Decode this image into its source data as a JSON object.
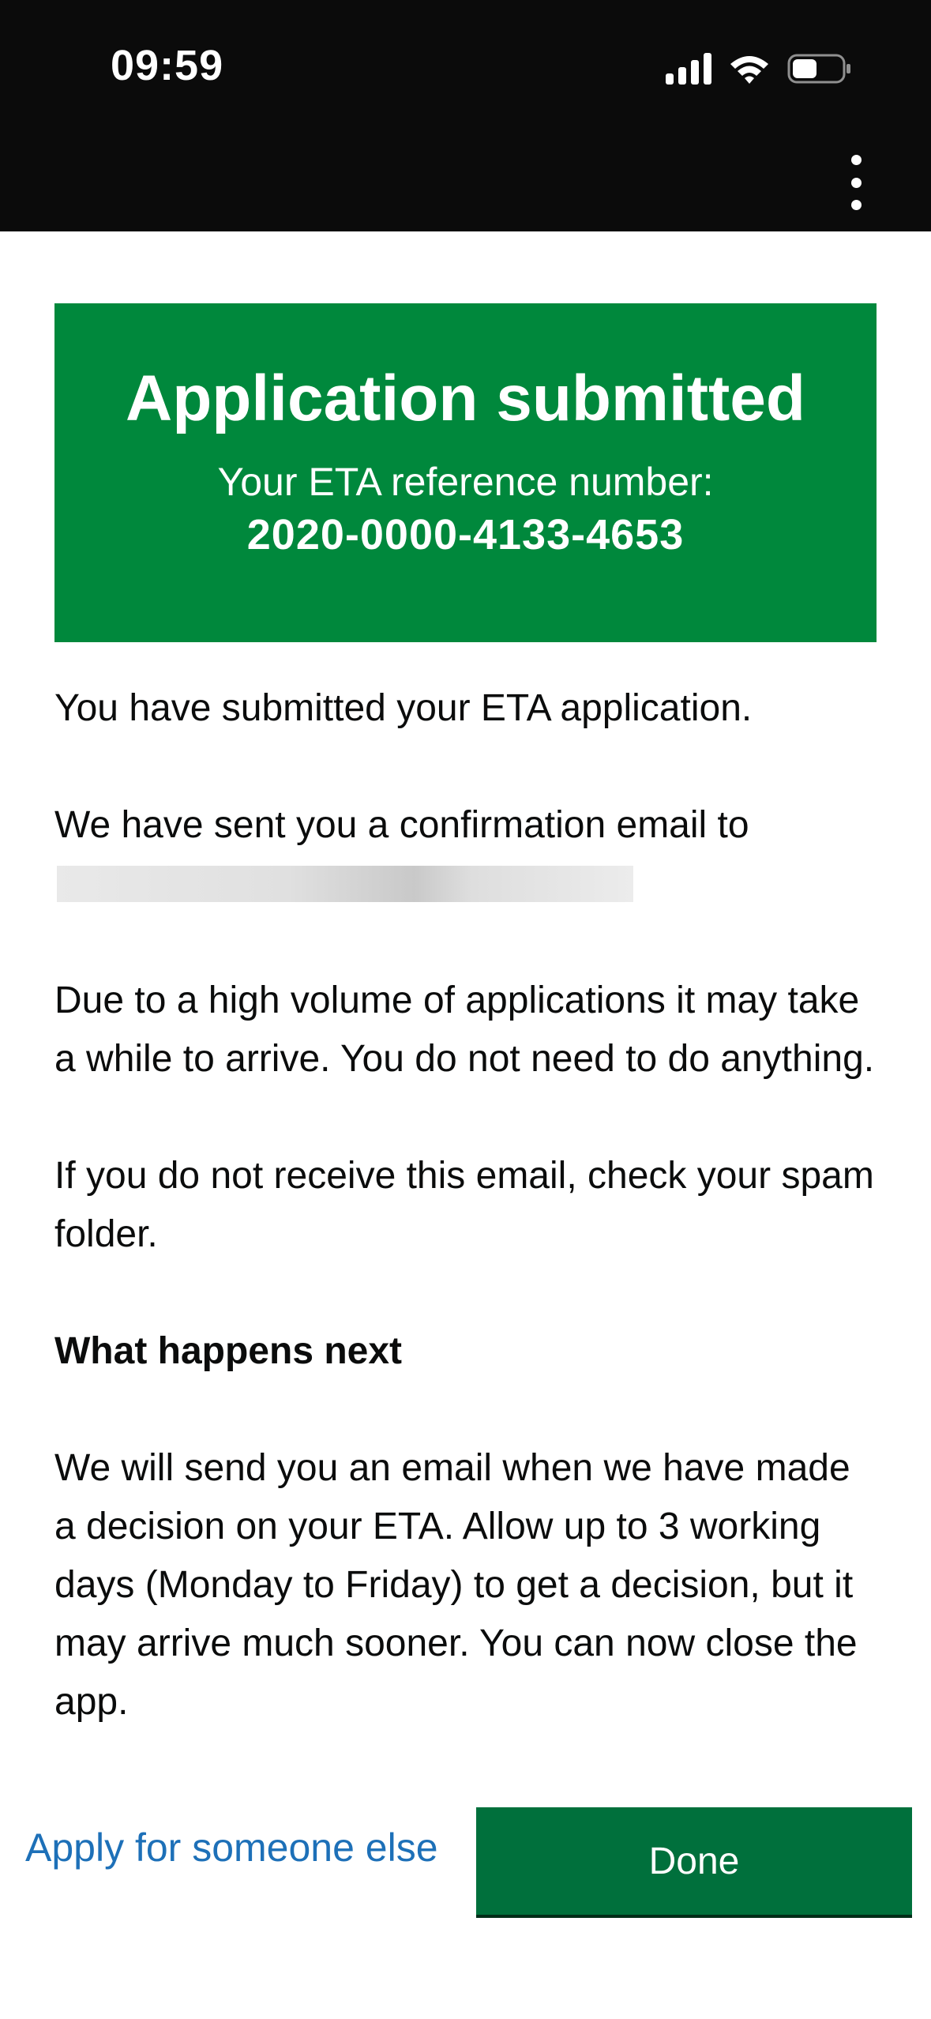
{
  "status_bar": {
    "time": "09:59",
    "icons": [
      "cellular-signal-icon",
      "wifi-icon",
      "battery-icon"
    ]
  },
  "header": {
    "menu_icon": "more-vertical-icon"
  },
  "confirmation_panel": {
    "title": "Application submitted",
    "reference_label": "Your ETA reference number:",
    "reference_number": "2020-0000-4133-4653",
    "color": "#00883c"
  },
  "body": {
    "para1": "You have submitted your ETA application.",
    "para2": "We have sent you a confirmation email to",
    "para3": "Due to a high volume of applications it may take a while to arrive. You do not need to do anything.",
    "para4": "If you do not receive this email, check your spam folder.",
    "heading": "What happens next",
    "para5": "We will send you an email when we have made a decision on your ETA. Allow up to 3 working days (Monday to Friday) to get a decision, but it may arrive much sooner. You can now close the app."
  },
  "footer": {
    "apply_link": "Apply for someone else",
    "done_button": "Done",
    "link_color": "#1d70b8",
    "button_color": "#00703c"
  }
}
